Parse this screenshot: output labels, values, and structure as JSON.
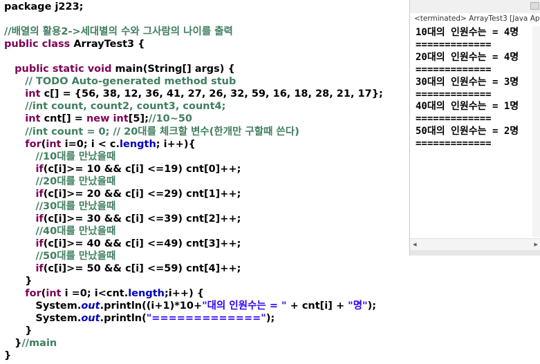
{
  "editor": {
    "lines": [
      [
        {
          "t": "package j223;",
          "c": "pl"
        }
      ],
      [],
      [
        {
          "t": "//배열의 활용2->세대별의 수와 그사람의 나이를 출력",
          "c": "cm"
        }
      ],
      [
        {
          "t": "public class ",
          "c": "kw"
        },
        {
          "t": "ArrayTest3 {",
          "c": "pl"
        }
      ],
      [],
      [
        {
          "t": "   ",
          "c": "pl"
        },
        {
          "t": "public static void ",
          "c": "kw"
        },
        {
          "t": "main(String[] args) {",
          "c": "pl"
        }
      ],
      [
        {
          "t": "      ",
          "c": "pl"
        },
        {
          "t": "// TODO Auto-generated method stub",
          "c": "cm"
        }
      ],
      [
        {
          "t": "      ",
          "c": "pl"
        },
        {
          "t": "int ",
          "c": "kw"
        },
        {
          "t": "c[] = {56, 38, 12, 36, 41, 27, 26, 32, 59, 16, 18, 28, 21, 17};",
          "c": "pl"
        }
      ],
      [
        {
          "t": "      ",
          "c": "pl"
        },
        {
          "t": "//int count, count2, count3, count4;",
          "c": "cm"
        }
      ],
      [
        {
          "t": "      ",
          "c": "pl"
        },
        {
          "t": "int ",
          "c": "kw"
        },
        {
          "t": "cnt[] = ",
          "c": "pl"
        },
        {
          "t": "new int",
          "c": "kw"
        },
        {
          "t": "[5];",
          "c": "pl"
        },
        {
          "t": "//10~50",
          "c": "cm"
        }
      ],
      [
        {
          "t": "      ",
          "c": "pl"
        },
        {
          "t": "//int count = 0; // 20대를 체크할 변수(한개만 구할때 쓴다)",
          "c": "cm"
        }
      ],
      [
        {
          "t": "      ",
          "c": "pl"
        },
        {
          "t": "for",
          "c": "kw"
        },
        {
          "t": "(",
          "c": "pl"
        },
        {
          "t": "int ",
          "c": "kw"
        },
        {
          "t": "i=0; i < c.",
          "c": "pl"
        },
        {
          "t": "length",
          "c": "fld"
        },
        {
          "t": "; i++){",
          "c": "pl"
        }
      ],
      [
        {
          "t": "         ",
          "c": "pl"
        },
        {
          "t": "//10대를 만났을때",
          "c": "cm"
        }
      ],
      [
        {
          "t": "         ",
          "c": "pl"
        },
        {
          "t": "if",
          "c": "kw"
        },
        {
          "t": "(c[i]>= 10 && c[i] <=19) cnt[0]++;",
          "c": "pl"
        }
      ],
      [
        {
          "t": "         ",
          "c": "pl"
        },
        {
          "t": "//20대를 만났을때",
          "c": "cm"
        }
      ],
      [
        {
          "t": "         ",
          "c": "pl"
        },
        {
          "t": "if",
          "c": "kw"
        },
        {
          "t": "(c[i]>= 20 && c[i] <=29) cnt[1]++;",
          "c": "pl"
        }
      ],
      [
        {
          "t": "         ",
          "c": "pl"
        },
        {
          "t": "//30대를 만났을때",
          "c": "cm"
        }
      ],
      [
        {
          "t": "         ",
          "c": "pl"
        },
        {
          "t": "if",
          "c": "kw"
        },
        {
          "t": "(c[i]>= 30 && c[i] <=39) cnt[2]++;",
          "c": "pl"
        }
      ],
      [
        {
          "t": "         ",
          "c": "pl"
        },
        {
          "t": "//40대를 만났을때",
          "c": "cm"
        }
      ],
      [
        {
          "t": "         ",
          "c": "pl"
        },
        {
          "t": "if",
          "c": "kw"
        },
        {
          "t": "(c[i]>= 40 && c[i] <=49) cnt[3]++;",
          "c": "pl"
        }
      ],
      [
        {
          "t": "         ",
          "c": "pl"
        },
        {
          "t": "//50대를 만났을때",
          "c": "cm"
        }
      ],
      [
        {
          "t": "         ",
          "c": "pl"
        },
        {
          "t": "if",
          "c": "kw"
        },
        {
          "t": "(c[i]>= 50 && c[i] <=59) cnt[4]++;",
          "c": "pl"
        }
      ],
      [
        {
          "t": "      }",
          "c": "pl"
        }
      ],
      [
        {
          "t": "      ",
          "c": "pl"
        },
        {
          "t": "for",
          "c": "kw"
        },
        {
          "t": "(",
          "c": "pl"
        },
        {
          "t": "int ",
          "c": "kw"
        },
        {
          "t": "i =0; i<cnt.",
          "c": "pl"
        },
        {
          "t": "length",
          "c": "fld"
        },
        {
          "t": ";i++) {",
          "c": "pl"
        }
      ],
      [
        {
          "t": "         System.",
          "c": "pl"
        },
        {
          "t": "out",
          "c": "it"
        },
        {
          "t": ".println((i+1)*10+",
          "c": "pl"
        },
        {
          "t": "\"대의 인원수는 = \"",
          "c": "str"
        },
        {
          "t": " + cnt[i] + ",
          "c": "pl"
        },
        {
          "t": "\"명\"",
          "c": "str"
        },
        {
          "t": ");",
          "c": "pl"
        }
      ],
      [
        {
          "t": "         System.",
          "c": "pl"
        },
        {
          "t": "out",
          "c": "it"
        },
        {
          "t": ".println(",
          "c": "pl"
        },
        {
          "t": "\"=============\"",
          "c": "str"
        },
        {
          "t": ");",
          "c": "pl"
        }
      ],
      [
        {
          "t": "      }",
          "c": "pl"
        }
      ],
      [
        {
          "t": "   }",
          "c": "pl"
        },
        {
          "t": "//main",
          "c": "cm"
        }
      ],
      [
        {
          "t": "}",
          "c": "pl"
        }
      ]
    ]
  },
  "console": {
    "status": "<terminated> ArrayTest3 [Java Ap",
    "output": [
      "10대의 인원수는 = 4명",
      "=============",
      "20대의 인원수는 = 4명",
      "=============",
      "30대의 인원수는 = 3명",
      "=============",
      "40대의 인원수는 = 1명",
      "=============",
      "50대의 인원수는 = 2명",
      "============="
    ],
    "scroll_left_icon": "chevron-left-icon",
    "scroll_left_glyph": "◂",
    "scroll_right_icon": "chevron-right-icon",
    "scroll_right_glyph": "▸"
  },
  "colors": {
    "keyword": "#7f0055",
    "comment": "#3f7f5f",
    "string": "#2a00ff",
    "field": "#0000c0"
  }
}
